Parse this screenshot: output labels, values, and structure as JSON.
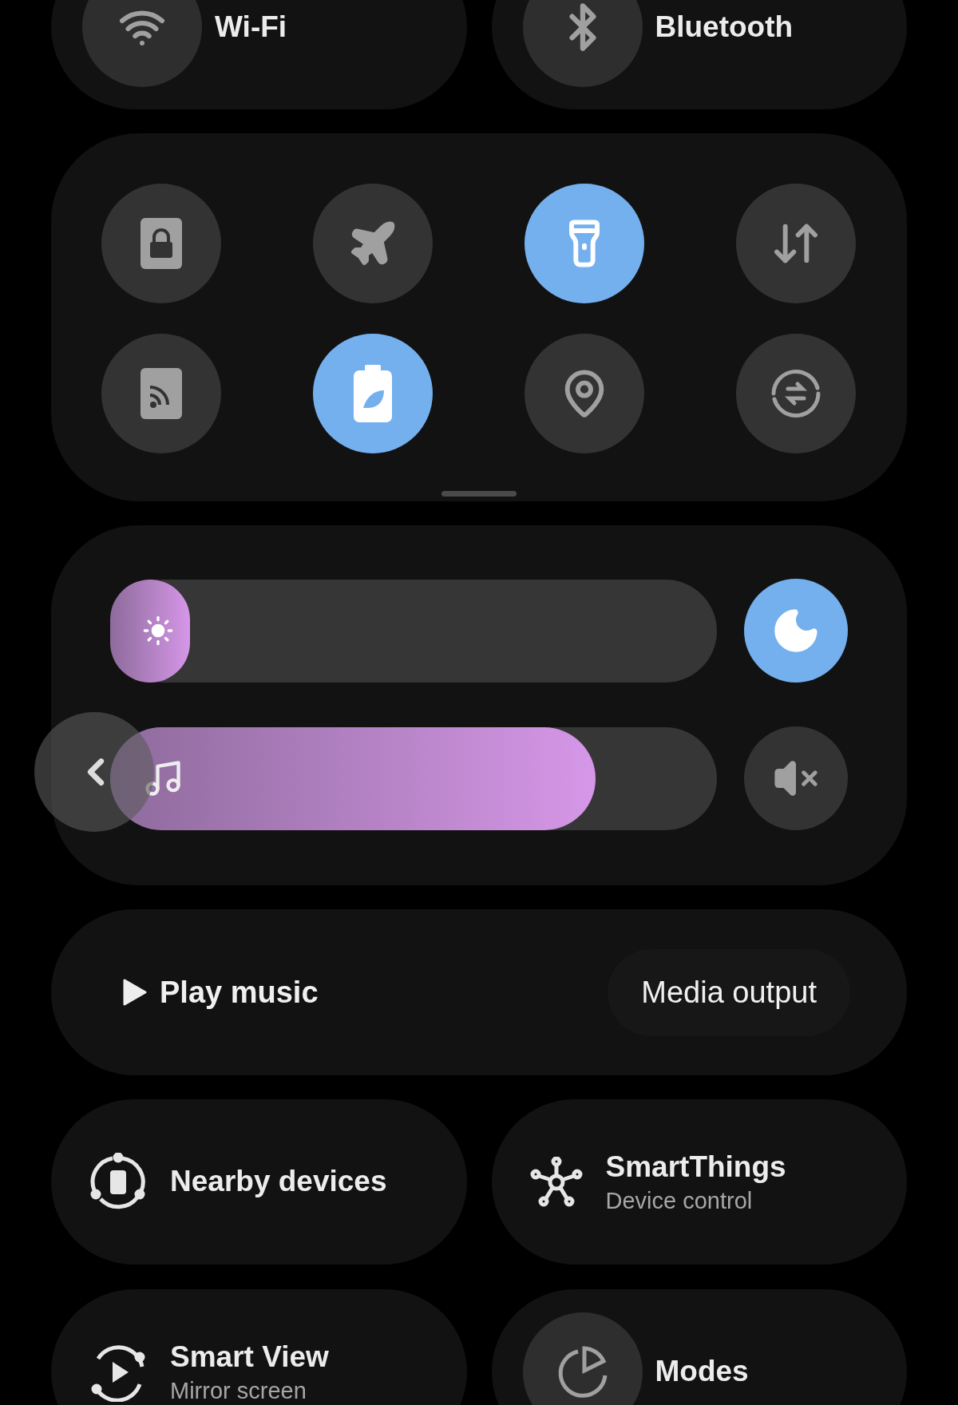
{
  "top_tiles": [
    {
      "kind": "wifi",
      "label": "Wi-Fi",
      "on": false
    },
    {
      "kind": "bluetooth",
      "label": "Bluetooth",
      "on": false
    }
  ],
  "quick_toggles": [
    {
      "kind": "secure-folder",
      "on": false
    },
    {
      "kind": "airplane",
      "on": false
    },
    {
      "kind": "flashlight",
      "on": true
    },
    {
      "kind": "mobile-data",
      "on": false
    },
    {
      "kind": "cast",
      "on": false
    },
    {
      "kind": "power-saving",
      "on": true
    },
    {
      "kind": "location",
      "on": false
    },
    {
      "kind": "sync",
      "on": false
    }
  ],
  "sliders": [
    {
      "kind": "brightness",
      "level": 0.13,
      "side_button": {
        "kind": "night",
        "on": true
      }
    },
    {
      "kind": "volume",
      "level": 0.8,
      "side_button": {
        "kind": "mute",
        "on": false
      }
    }
  ],
  "media": {
    "play_label": "Play music",
    "output_button": "Media output"
  },
  "tiles": [
    {
      "kind": "nearby",
      "title": "Nearby devices"
    },
    {
      "kind": "smartthings",
      "title": "SmartThings",
      "subtitle": "Device control"
    },
    {
      "kind": "smart-view",
      "title": "Smart View",
      "subtitle": "Mirror screen"
    },
    {
      "kind": "modes",
      "title": "Modes"
    }
  ]
}
